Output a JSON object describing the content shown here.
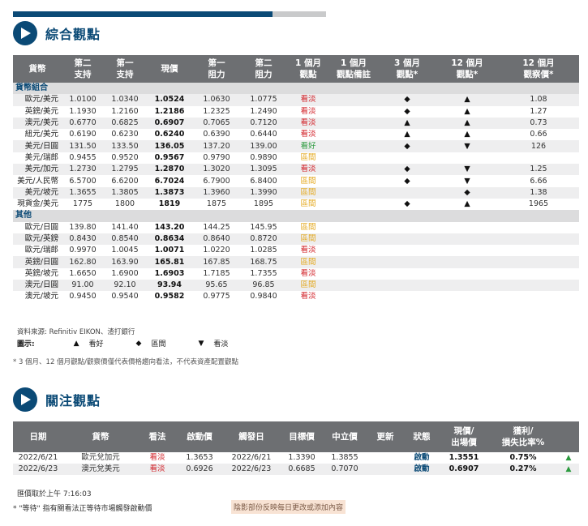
{
  "progress": {
    "fraction": 0.83,
    "color_fill": "#0b4a76",
    "color_track": "#c9cacb"
  },
  "section1": {
    "title": "綜合觀點",
    "icon": "play-icon"
  },
  "table1": {
    "headers": [
      "貨幣",
      "第二\n支持",
      "第一\n支持",
      "現價",
      "第一\n阻力",
      "第二\n阻力",
      "1 個月\n觀點",
      "1 個月\n觀點備註",
      "3 個月\n觀點*",
      "12 個月\n觀點*",
      "12 個月\n觀察價*"
    ],
    "groups": [
      {
        "name": "貨幣組合",
        "rows": [
          {
            "pair": "歐元/美元",
            "s2": "1.0100",
            "s1": "1.0340",
            "cur": "1.0524",
            "r1": "1.0630",
            "r2": "1.0775",
            "v1": "看淡",
            "v1c": "bear",
            "note": "",
            "v3": "◆",
            "v12": "▲",
            "target": "1.08"
          },
          {
            "pair": "英鎊/美元",
            "s2": "1.1930",
            "s1": "1.2160",
            "cur": "1.2186",
            "r1": "1.2325",
            "r2": "1.2490",
            "v1": "看淡",
            "v1c": "bear",
            "note": "",
            "v3": "◆",
            "v12": "▲",
            "target": "1.27"
          },
          {
            "pair": "澳元/美元",
            "s2": "0.6770",
            "s1": "0.6825",
            "cur": "0.6907",
            "r1": "0.7065",
            "r2": "0.7120",
            "v1": "看淡",
            "v1c": "bear",
            "note": "",
            "v3": "▲",
            "v12": "▲",
            "target": "0.73"
          },
          {
            "pair": "紐元/美元",
            "s2": "0.6190",
            "s1": "0.6230",
            "cur": "0.6240",
            "r1": "0.6390",
            "r2": "0.6440",
            "v1": "看淡",
            "v1c": "bear",
            "note": "",
            "v3": "▲",
            "v12": "▲",
            "target": "0.66"
          },
          {
            "pair": "美元/日圓",
            "s2": "131.50",
            "s1": "133.50",
            "cur": "136.05",
            "r1": "137.20",
            "r2": "139.00",
            "v1": "看好",
            "v1c": "bull",
            "note": "",
            "v3": "◆",
            "v12": "▼",
            "target": "126"
          },
          {
            "pair": "美元/瑞郎",
            "s2": "0.9455",
            "s1": "0.9520",
            "cur": "0.9567",
            "r1": "0.9790",
            "r2": "0.9890",
            "v1": "區間",
            "v1c": "neut",
            "note": "",
            "v3": "",
            "v12": "",
            "target": ""
          },
          {
            "pair": "美元/加元",
            "s2": "1.2730",
            "s1": "1.2795",
            "cur": "1.2870",
            "r1": "1.3020",
            "r2": "1.3095",
            "v1": "看淡",
            "v1c": "bear",
            "note": "",
            "v3": "◆",
            "v12": "▼",
            "target": "1.25"
          },
          {
            "pair": "美元/人民幣",
            "s2": "6.5700",
            "s1": "6.6200",
            "cur": "6.7024",
            "r1": "6.7900",
            "r2": "6.8400",
            "v1": "區間",
            "v1c": "neut",
            "note": "",
            "v3": "◆",
            "v12": "▼",
            "target": "6.66"
          },
          {
            "pair": "美元/坡元",
            "s2": "1.3655",
            "s1": "1.3805",
            "cur": "1.3873",
            "r1": "1.3960",
            "r2": "1.3990",
            "v1": "區間",
            "v1c": "neut",
            "note": "",
            "v3": "",
            "v12": "◆",
            "target": "1.38"
          },
          {
            "pair": "現貨金/美元",
            "s2": "1775",
            "s1": "1800",
            "cur": "1819",
            "r1": "1875",
            "r2": "1895",
            "v1": "區間",
            "v1c": "neut",
            "note": "",
            "v3": "◆",
            "v12": "▲",
            "target": "1965"
          }
        ]
      },
      {
        "name": "其他",
        "rows": [
          {
            "pair": "歐元/日圓",
            "s2": "139.80",
            "s1": "141.40",
            "cur": "143.20",
            "r1": "144.25",
            "r2": "145.95",
            "v1": "區間",
            "v1c": "neut",
            "note": "",
            "v3": "",
            "v12": "",
            "target": ""
          },
          {
            "pair": "歐元/英鎊",
            "s2": "0.8430",
            "s1": "0.8540",
            "cur": "0.8634",
            "r1": "0.8640",
            "r2": "0.8720",
            "v1": "區間",
            "v1c": "neut",
            "note": "",
            "v3": "",
            "v12": "",
            "target": ""
          },
          {
            "pair": "歐元/瑞郎",
            "s2": "0.9970",
            "s1": "1.0045",
            "cur": "1.0071",
            "r1": "1.0220",
            "r2": "1.0285",
            "v1": "看淡",
            "v1c": "bear",
            "note": "",
            "v3": "",
            "v12": "",
            "target": ""
          },
          {
            "pair": "英鎊/日圓",
            "s2": "162.80",
            "s1": "163.90",
            "cur": "165.81",
            "r1": "167.85",
            "r2": "168.75",
            "v1": "區間",
            "v1c": "neut",
            "note": "",
            "v3": "",
            "v12": "",
            "target": ""
          },
          {
            "pair": "英鎊/坡元",
            "s2": "1.6650",
            "s1": "1.6900",
            "cur": "1.6903",
            "r1": "1.7185",
            "r2": "1.7355",
            "v1": "看淡",
            "v1c": "bear",
            "note": "",
            "v3": "",
            "v12": "",
            "target": ""
          },
          {
            "pair": "澳元/日圓",
            "s2": "91.00",
            "s1": "92.10",
            "cur": "93.94",
            "r1": "95.65",
            "r2": "96.85",
            "v1": "區間",
            "v1c": "neut",
            "note": "",
            "v3": "",
            "v12": "",
            "target": ""
          },
          {
            "pair": "澳元/坡元",
            "s2": "0.9450",
            "s1": "0.9540",
            "cur": "0.9582",
            "r1": "0.9775",
            "r2": "0.9840",
            "v1": "看淡",
            "v1c": "bear",
            "note": "",
            "v3": "",
            "v12": "",
            "target": ""
          }
        ]
      }
    ]
  },
  "source": "資料來源: Refinitiv EIKON、渣打銀行",
  "legend": {
    "label": "圖示:",
    "items": [
      {
        "sym": "▲",
        "text": "看好"
      },
      {
        "sym": "◆",
        "text": "區間"
      },
      {
        "sym": "▼",
        "text": "看淡"
      }
    ]
  },
  "note1": "* 3 個月、12 個月觀點/觀察價僅代表價格趨向看法，不代表資產配置觀點",
  "section2": {
    "title": "關注觀點",
    "icon": "play-icon"
  },
  "table2": {
    "headers": [
      "日期",
      "貨幣",
      "看法",
      "啟動價",
      "觸發日",
      "目標價",
      "中立價",
      "更新",
      "狀態",
      "現價/\n出場價",
      "獲利/\n損失比率%",
      ""
    ],
    "rows": [
      {
        "date": "2022/6/21",
        "pair": "歐元兌加元",
        "view": "看淡",
        "entry": "1.3653",
        "trigger": "2022/6/21",
        "target": "1.3390",
        "neutral": "1.3855",
        "update": "",
        "status": "啟動",
        "price": "1.3551",
        "pl": "0.75%",
        "arrow": "▲"
      },
      {
        "date": "2022/6/23",
        "pair": "澳元兌美元",
        "view": "看淡",
        "entry": "0.6926",
        "trigger": "2022/6/23",
        "target": "0.6685",
        "neutral": "0.7070",
        "update": "",
        "status": "啟動",
        "price": "0.6907",
        "pl": "0.27%",
        "arrow": "▲"
      }
    ]
  },
  "quote_time": "匯價取於上午 7:16:03",
  "note2": "* \"等待\" 指有關看法正等待市場觸發啟動價",
  "shade_note": "陰影部份反映每日更改或添加內容"
}
